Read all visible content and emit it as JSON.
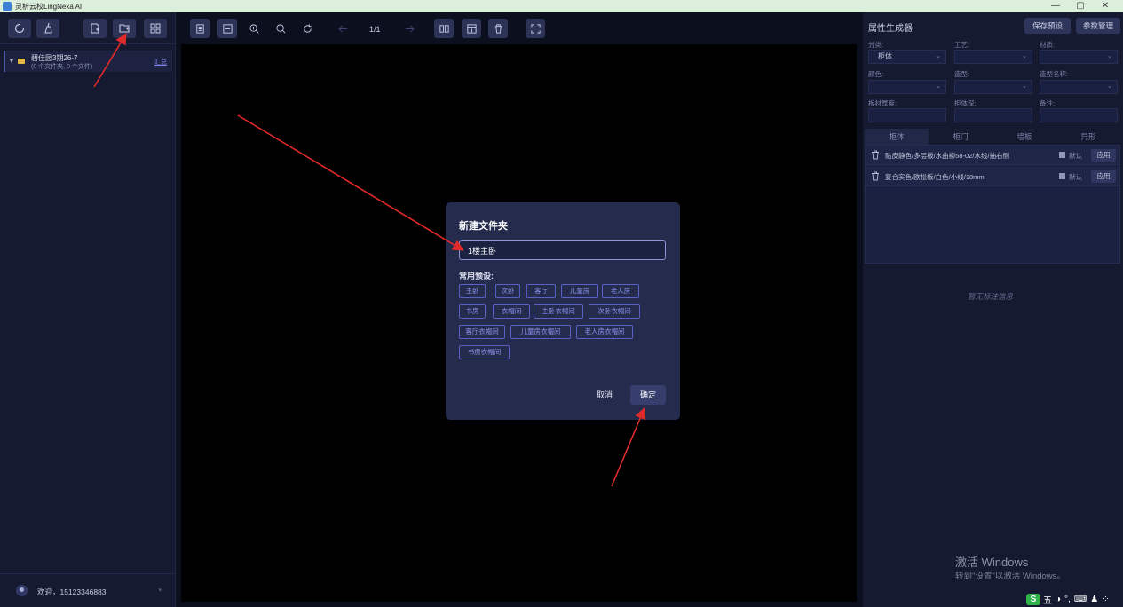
{
  "window": {
    "title": "灵析云校LingNexa AI",
    "controls": [
      "—",
      "▢",
      "✕"
    ]
  },
  "left_panel": {
    "tree": {
      "name": "碧佳园3期26-7",
      "sub": "(0 个文件夹, 0 个文件)",
      "link": "汇总"
    },
    "user": {
      "welcome": "欢迎，15123346883"
    }
  },
  "center": {
    "page_indicator": "1/1"
  },
  "modal": {
    "title": "新建文件夹",
    "input_value": "1楼主卧",
    "preset_label": "常用预设:",
    "presets": [
      "主卧",
      "次卧",
      "客厅",
      "儿童房",
      "老人房",
      "书房",
      "衣帽间",
      "主卧衣帽间",
      "次卧衣帽间",
      "客厅衣帽间",
      "儿童房衣帽间",
      "老人房衣帽间",
      "书房衣帽间"
    ],
    "cancel": "取消",
    "confirm": "确定"
  },
  "right_panel": {
    "title": "属性生成器",
    "save_preset": "保存预设",
    "param_manage": "参数管理",
    "fields": {
      "category_label": "分类:",
      "category_value": "柜体",
      "craft_label": "工艺:",
      "material_label": "材质:",
      "color_label": "颜色:",
      "shape_label": "造型:",
      "shape_name_label": "造型名称:",
      "thickness_label": "板材厚度:",
      "depth_label": "柜体深:",
      "note_label": "备注:"
    },
    "tabs": [
      "柜体",
      "柜门",
      "墙板",
      "异形"
    ],
    "attrs": [
      {
        "text": "贴皮静色/多层板/水曲柳58-02/水线/抽右侧",
        "default": "默认",
        "apply": "应用"
      },
      {
        "text": "复合实色/欧松板/白色/小线/18mm",
        "default": "默认",
        "apply": "应用"
      }
    ],
    "empty_note": "暂无标注信息",
    "watermark": "激活 Windows",
    "watermark_sub": "转到\"设置\"以激活 Windows。",
    "ime": [
      "S",
      "五",
      "◑",
      "°,",
      "⌨",
      "♟",
      "⁘"
    ]
  },
  "colors": {
    "annotation": "#e02a2a",
    "accent": "#5a61c5"
  }
}
